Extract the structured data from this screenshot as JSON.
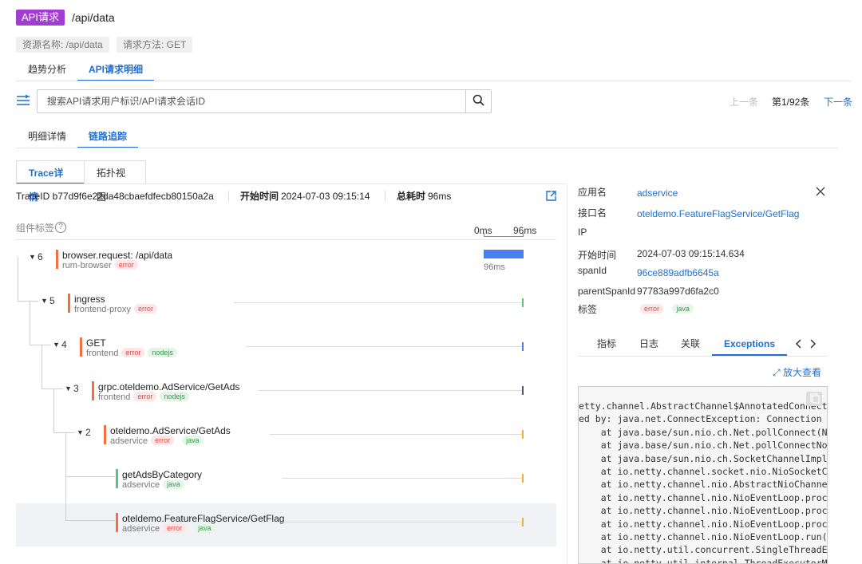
{
  "header": {
    "badge": "API请求",
    "title": "/api/data"
  },
  "chips": [
    "资源名称: /api/data",
    "请求方法: GET"
  ],
  "main_tabs": [
    "趋势分析",
    "API请求明细"
  ],
  "search": {
    "placeholder": "搜索API请求用户标识/API请求会话ID"
  },
  "pager": {
    "prev": "上一条",
    "current": "第1/92条",
    "next": "下一条"
  },
  "sub_tabs": [
    "明细详情",
    "链路追踪"
  ],
  "view_tabs": [
    "Trace详情",
    "拓扑视图"
  ],
  "trace_meta": {
    "trace_id": "TraceID b77d9f6e22da48cbaefdfecb80150a2a",
    "start_label": "开始时间",
    "start_value": "2024-07-03 09:15:14",
    "total_label": "总耗时",
    "total_value": "96ms"
  },
  "component_tag_label": "组件标签",
  "timeline": {
    "start": "0ms",
    "end": "96ms",
    "root_duration": "96ms"
  },
  "spans": [
    {
      "count": "6",
      "name": "browser.request: /api/data",
      "service": "rum-browser",
      "badges": [
        "error"
      ],
      "color": "#f07040"
    },
    {
      "count": "5",
      "name": "ingress",
      "service": "frontend-proxy",
      "badges": [
        "error"
      ],
      "color": "#f07040"
    },
    {
      "count": "4",
      "name": "GET",
      "service": "frontend",
      "badges": [
        "error",
        "nodejs"
      ],
      "color": "#f07040"
    },
    {
      "count": "3",
      "name": "grpc.oteldemo.AdService/GetAds",
      "service": "frontend",
      "badges": [
        "error",
        "nodejs"
      ],
      "color": "#f07040"
    },
    {
      "count": "2",
      "name": "oteldemo.AdService/GetAds",
      "service": "adservice",
      "badges": [
        "error",
        "java"
      ],
      "color": "#f07040"
    },
    {
      "count": "",
      "name": "getAdsByCategory",
      "service": "adservice",
      "badges": [
        "java"
      ],
      "color": "#5cc47a"
    },
    {
      "count": "",
      "name": "oteldemo.FeatureFlagService/GetFlag",
      "service": "adservice",
      "badges": [
        "error",
        "java"
      ],
      "color": "#f07040"
    }
  ],
  "detail": {
    "app_label": "应用名",
    "app_value": "adservice",
    "iface_label": "接口名",
    "iface_value": "oteldemo.FeatureFlagService/GetFlag",
    "ip_label": "IP",
    "start_label": "开始时间",
    "start_value": "2024-07-03 09:15:14.634",
    "span_label": "spanId",
    "span_value": "96ce889adfb6645a",
    "parent_label": "parentSpanId",
    "parent_value": "97783a997d6fa2c0",
    "tags_label": "标签",
    "tags": [
      "error",
      "java"
    ]
  },
  "detail_tabs": [
    "指标",
    "日志",
    "关联",
    "Exceptions"
  ],
  "expand_label": "放大查看",
  "exception_lines": [
    "etty.channel.AbstractChannel$AnnotatedConnectE",
    "ed by: java.net.ConnectException: Connection r",
    "    at java.base/sun.nio.ch.Net.pollConnect(Na",
    "    at java.base/sun.nio.ch.Net.pollConnectNow",
    "    at java.base/sun.nio.ch.SocketChannelImpl.",
    "    at io.netty.channel.socket.nio.NioSocketCh",
    "    at io.netty.channel.nio.AbstractNioChannel",
    "    at io.netty.channel.nio.NioEventLoop.proce",
    "    at io.netty.channel.nio.NioEventLoop.proce",
    "    at io.netty.channel.nio.NioEventLoop.proce",
    "    at io.netty.channel.nio.NioEventLoop.run(N",
    "    at io.netty.util.concurrent.SingleThreadEv",
    "    at io.netty.util.internal.ThreadExecutorMa"
  ],
  "colors": {
    "accent": "#1f6fd1",
    "brand": "#a23ecf",
    "error": "#e24a4a",
    "ok": "#3a9a4f",
    "bar": "#4a7ff0"
  }
}
